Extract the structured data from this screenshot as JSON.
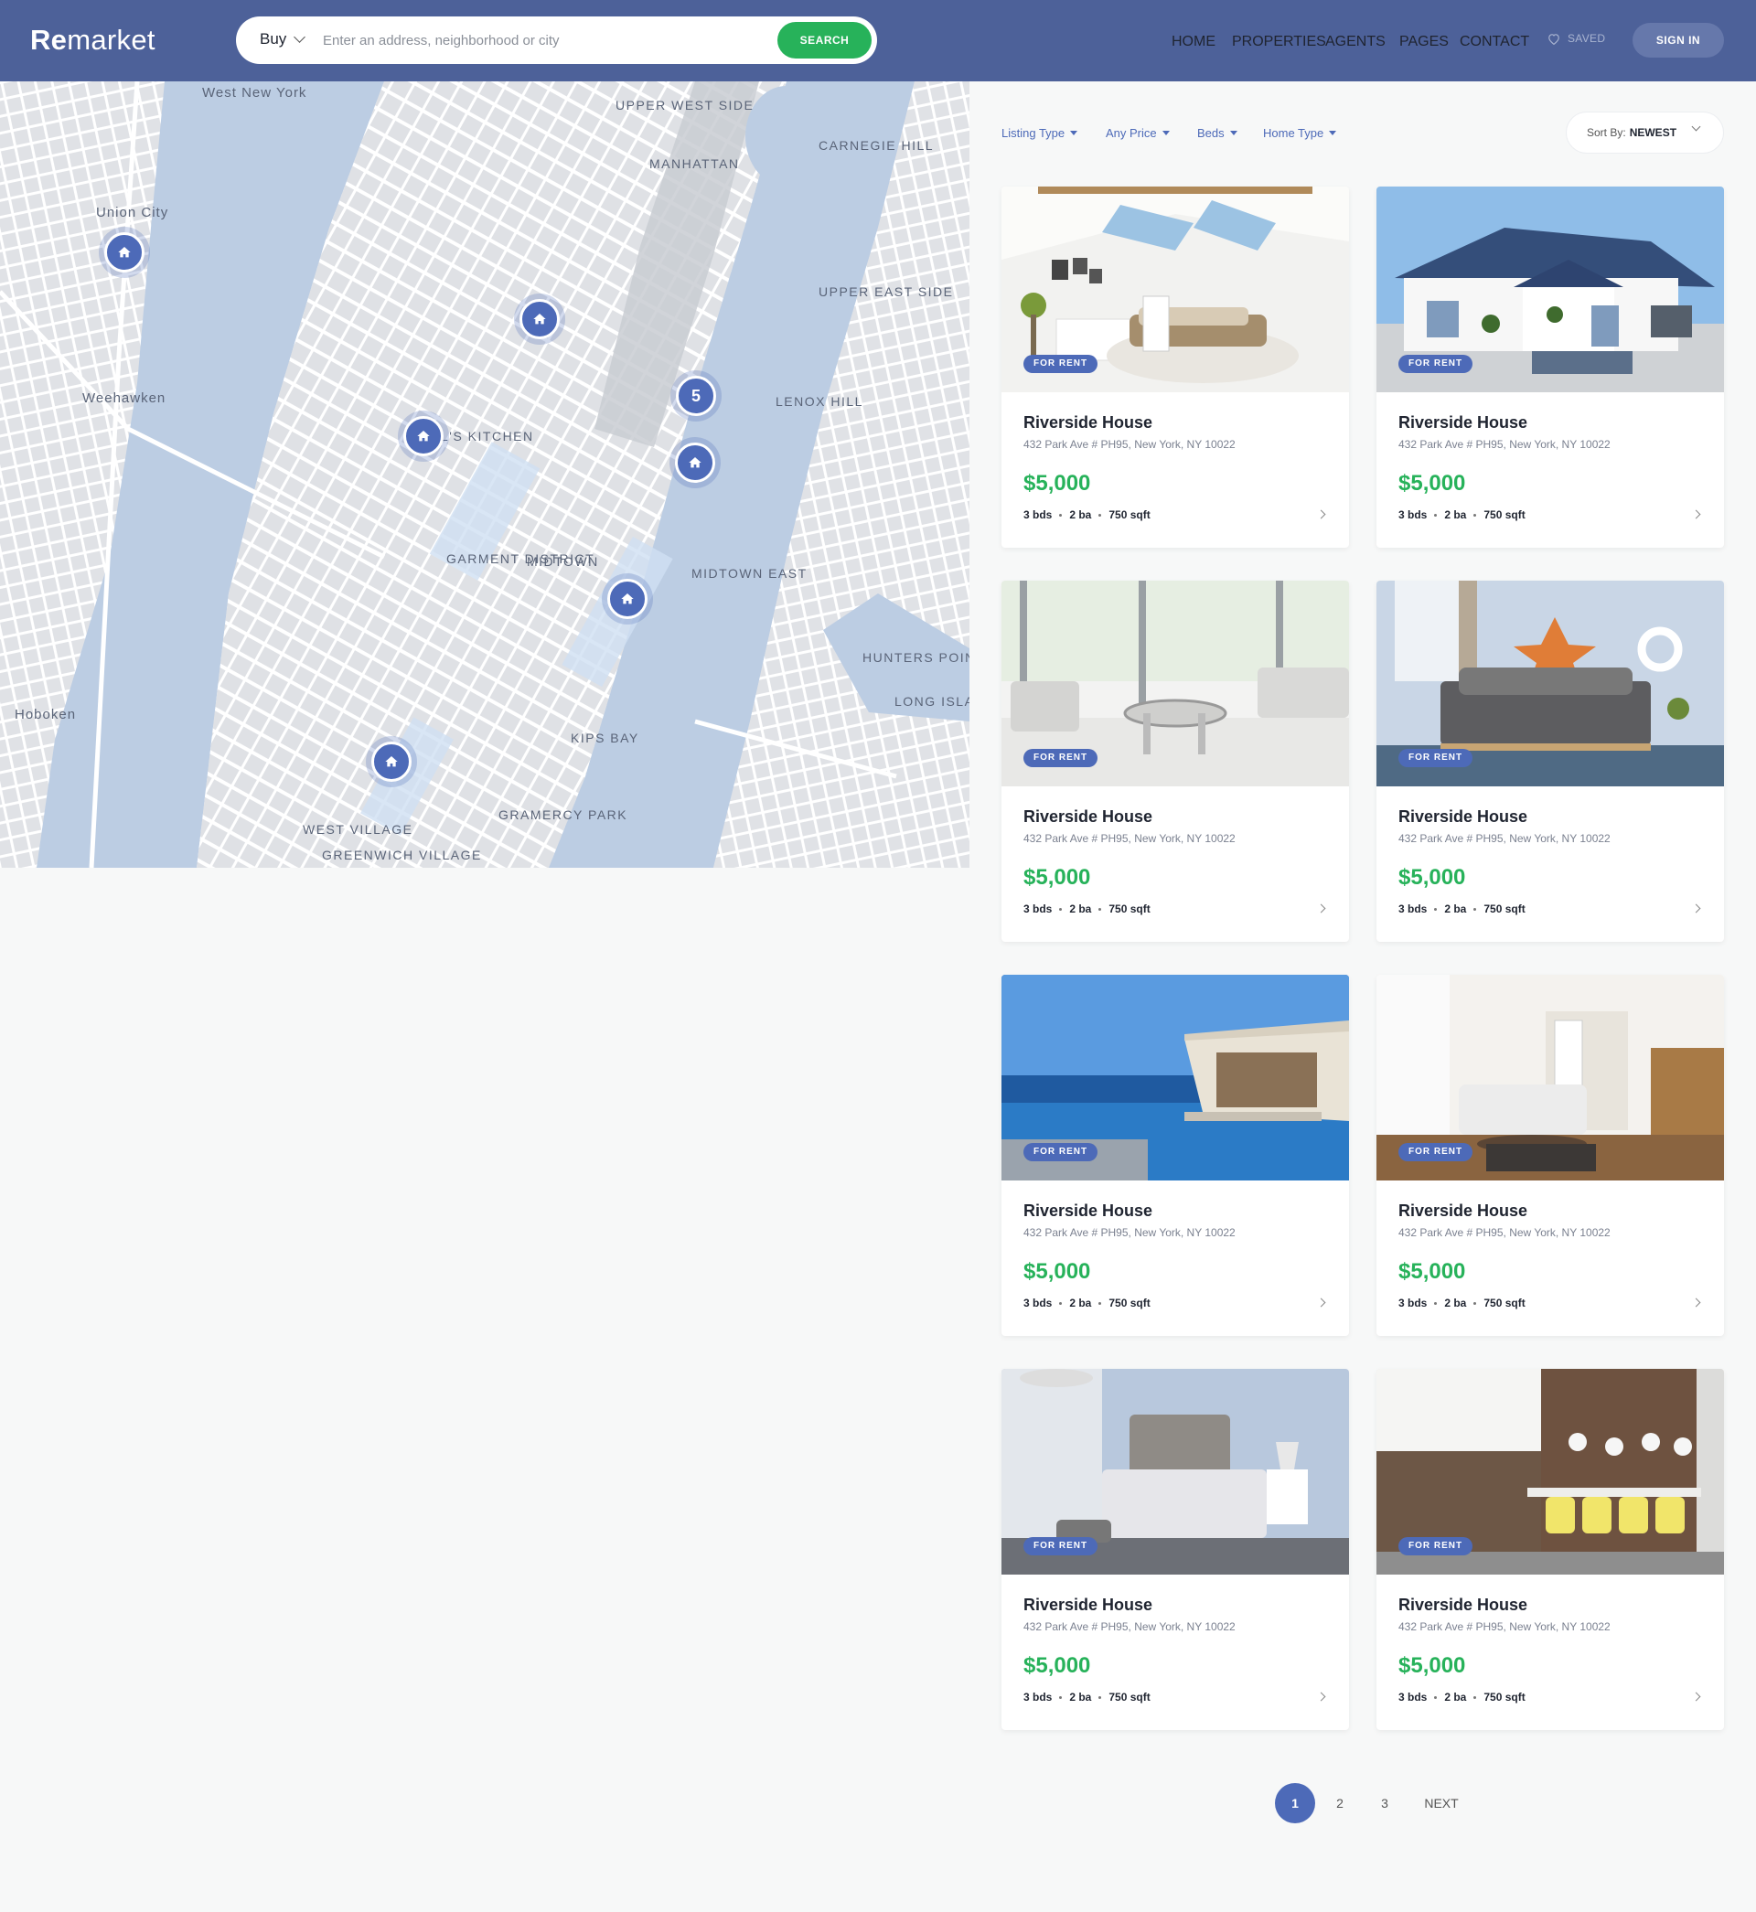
{
  "header": {
    "logo_bold": "Re",
    "logo_rest": "market",
    "search_type": "Buy",
    "search_placeholder": "Enter an address, neighborhood or city",
    "search_button": "SEARCH",
    "nav": [
      "HOME",
      "PROPERTIES",
      "AGENTS",
      "PAGES",
      "CONTACT"
    ],
    "saved": "SAVED",
    "signin": "SIGN IN",
    "brand_color": "#4d6199",
    "accent_green": "#27b25a"
  },
  "map": {
    "cluster_count": "5",
    "labels": [
      "West New York",
      "Union City",
      "Weehawken",
      "UPPER WEST SIDE",
      "MANHATTAN",
      "CARNEGIE HILL",
      "UPPER EAST SIDE",
      "LENOX HILL",
      "L'S KITCHEN",
      "GARMENT DISTRICT",
      "MIDTOWN",
      "MIDTOWN EAST",
      "HUNTERS POINT",
      "LONG ISLAND CIT",
      "Hoboken",
      "KIPS BAY",
      "GRAMERCY PARK",
      "WEST VILLAGE",
      "GREENWICH VILLAGE"
    ]
  },
  "filters": {
    "items": [
      "Listing Type",
      "Any Price",
      "Beds",
      "Home Type"
    ],
    "sort_label": "Sort By:",
    "sort_value": "NEWEST"
  },
  "listings": [
    {
      "badge": "FOR RENT",
      "title": "Riverside House",
      "address": "432 Park Ave # PH95, New York, NY 10022",
      "price": "$5,000",
      "beds": "3 bds",
      "baths": "2 ba",
      "area": "750 sqft",
      "photo": "attic-bedroom"
    },
    {
      "badge": "FOR RENT",
      "title": "Riverside House",
      "address": "432 Park Ave # PH95, New York, NY 10022",
      "price": "$5,000",
      "beds": "3 bds",
      "baths": "2 ba",
      "area": "750 sqft",
      "photo": "white-villa"
    },
    {
      "badge": "FOR RENT",
      "title": "Riverside House",
      "address": "432 Park Ave # PH95, New York, NY 10022",
      "price": "$5,000",
      "beds": "3 bds",
      "baths": "2 ba",
      "area": "750 sqft",
      "photo": "white-living-room"
    },
    {
      "badge": "FOR RENT",
      "title": "Riverside House",
      "address": "432 Park Ave # PH95, New York, NY 10022",
      "price": "$5,000",
      "beds": "3 bds",
      "baths": "2 ba",
      "area": "750 sqft",
      "photo": "nautical-bedroom"
    },
    {
      "badge": "FOR RENT",
      "title": "Riverside House",
      "address": "432 Park Ave # PH95, New York, NY 10022",
      "price": "$5,000",
      "beds": "3 bds",
      "baths": "2 ba",
      "area": "750 sqft",
      "photo": "sea-pool-house"
    },
    {
      "badge": "FOR RENT",
      "title": "Riverside House",
      "address": "432 Park Ave # PH95, New York, NY 10022",
      "price": "$5,000",
      "beds": "3 bds",
      "baths": "2 ba",
      "area": "750 sqft",
      "photo": "bright-lounge"
    },
    {
      "badge": "FOR RENT",
      "title": "Riverside House",
      "address": "432 Park Ave # PH95, New York, NY 10022",
      "price": "$5,000",
      "beds": "3 bds",
      "baths": "2 ba",
      "area": "750 sqft",
      "photo": "grey-bedroom"
    },
    {
      "badge": "FOR RENT",
      "title": "Riverside House",
      "address": "432 Park Ave # PH95, New York, NY 10022",
      "price": "$5,000",
      "beds": "3 bds",
      "baths": "2 ba",
      "area": "750 sqft",
      "photo": "kitchen-dining"
    }
  ],
  "pagination": {
    "pages": [
      "1",
      "2",
      "3"
    ],
    "current": "1",
    "next": "NEXT"
  }
}
